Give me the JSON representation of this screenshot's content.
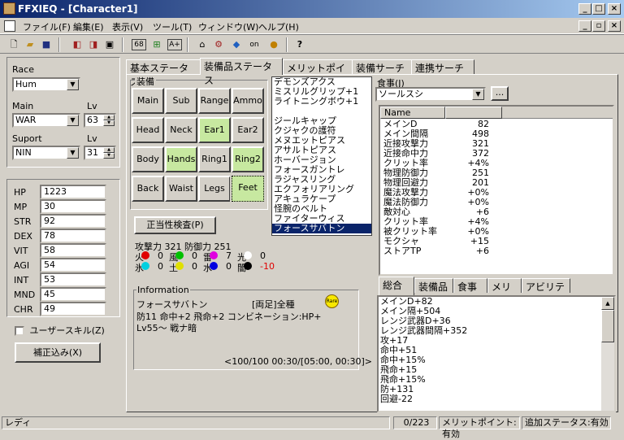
{
  "window": {
    "title": "FFXIEQ - [Character1]"
  },
  "menu": [
    "ファイル(F)",
    "編集(E)",
    "表示(V)",
    "ツール(T)",
    "ウィンドウ(W)",
    "ヘルプ(H)"
  ],
  "character": {
    "race_label": "Race",
    "race_value": "Hum",
    "main_label": "Main",
    "main_value": "WAR",
    "main_lv_label": "Lv",
    "main_lv_value": "63",
    "sub_label": "Suport",
    "sub_value": "NIN",
    "sub_lv_label": "Lv",
    "sub_lv_value": "31"
  },
  "stats": [
    {
      "label": "HP",
      "value": "1223"
    },
    {
      "label": "MP",
      "value": "30"
    },
    {
      "label": "STR",
      "value": "92"
    },
    {
      "label": "DEX",
      "value": "78"
    },
    {
      "label": "VIT",
      "value": "58"
    },
    {
      "label": "AGI",
      "value": "54"
    },
    {
      "label": "INT",
      "value": "53"
    },
    {
      "label": "MND",
      "value": "45"
    },
    {
      "label": "CHR",
      "value": "49"
    }
  ],
  "user_skill_label": "ユーザースキル(Z)",
  "correction_button": "補正込み(X)",
  "tabs": [
    "基本ステータス",
    "装備品ステータス",
    "メリットポイント",
    "装備サーチ",
    "連携サーチ"
  ],
  "equip": {
    "group_label": "装備",
    "slots": [
      {
        "label": "Main",
        "on": false
      },
      {
        "label": "Sub",
        "on": false
      },
      {
        "label": "Range",
        "on": false
      },
      {
        "label": "Ammo",
        "on": false
      },
      {
        "label": "Head",
        "on": false
      },
      {
        "label": "Neck",
        "on": false
      },
      {
        "label": "Ear1",
        "on": true
      },
      {
        "label": "Ear2",
        "on": false
      },
      {
        "label": "Body",
        "on": false
      },
      {
        "label": "Hands",
        "on": true
      },
      {
        "label": "Ring1",
        "on": false
      },
      {
        "label": "Ring2",
        "on": true
      },
      {
        "label": "Back",
        "on": false
      },
      {
        "label": "Waist",
        "on": false
      },
      {
        "label": "Legs",
        "on": false
      },
      {
        "label": "Feet",
        "on": true
      }
    ],
    "validate_button": "正当性検査(P)"
  },
  "equip_list": [
    "デモンズアクス",
    "ミスリルグリップ+1",
    "ライトニングボウ+1",
    "",
    "ジールキャップ",
    "クジャクの護符",
    "メヌエットピアス",
    "アサルトピアス",
    "ホーバージョン",
    "フォースガントレ",
    "ラジャスリング",
    "エクフォリアリング",
    "アキュラケープ",
    "怪腕のベルト",
    "ファイターウィス",
    "フォースサバトン"
  ],
  "equip_list_selected": 15,
  "atk_def": {
    "attack_label": "攻撃力",
    "attack": "321",
    "defense_label": "防御力",
    "defense": "251"
  },
  "elements": [
    {
      "label": "火",
      "color": "#e00000",
      "value": "0"
    },
    {
      "label": "風",
      "color": "#00c000",
      "value": "0"
    },
    {
      "label": "雷",
      "color": "#e000e0",
      "value": "7"
    },
    {
      "label": "光",
      "color": "#ffffff",
      "value": "0"
    },
    {
      "label": "氷",
      "color": "#00d0e0",
      "value": "0"
    },
    {
      "label": "土",
      "color": "#e0e000",
      "value": "0"
    },
    {
      "label": "水",
      "color": "#0000e0",
      "value": "0"
    },
    {
      "label": "闇",
      "color": "#000000",
      "value": "-10"
    }
  ],
  "info": {
    "group_label": "Information",
    "item_name": "フォースサバトン",
    "restriction": "[両足]全種",
    "rare_badge": "Rare",
    "stats_line": "防11 命中+2 飛命+2 コンビネーション:HP+",
    "level_line": "Lv55～ 戦ナ暗",
    "durability": "<100/100 00:30/[05:00, 00:30]>"
  },
  "food": {
    "label": "食事(J)",
    "value": "ソールスシ",
    "button": "..."
  },
  "status_table": {
    "header": "Name",
    "rows": [
      {
        "name": "メインD",
        "value": "82"
      },
      {
        "name": "メイン間隔",
        "value": "498"
      },
      {
        "name": "近接攻撃力",
        "value": "321"
      },
      {
        "name": "近接命中力",
        "value": "372"
      },
      {
        "name": "クリット率",
        "value": "+4%"
      },
      {
        "name": "物理防御力",
        "value": "251"
      },
      {
        "name": "物理回避力",
        "value": "201"
      },
      {
        "name": "魔法攻撃力",
        "value": "+0%"
      },
      {
        "name": "魔法防御力",
        "value": "+0%"
      },
      {
        "name": "敵対心",
        "value": "+6"
      },
      {
        "name": "クリット率",
        "value": "+4%"
      },
      {
        "name": "被クリット率",
        "value": "+0%"
      },
      {
        "name": "モクシャ",
        "value": "+15"
      },
      {
        "name": "ストアTP",
        "value": "+6"
      }
    ]
  },
  "sub_tabs": [
    "総合",
    "装備品",
    "食事",
    "メリポ",
    "アビリティ"
  ],
  "summary_lines": [
    "メインD+82",
    "メイン隔+504",
    "レンジ武器D+36",
    "レンジ武器間隔+352",
    "攻+17",
    "命中+51",
    "命中+15%",
    "飛命+15",
    "飛命+15%",
    "防+131",
    "回避-22"
  ],
  "statusbar": {
    "left": "レディ",
    "count": "0/223",
    "merit": "メリットポイント:有効",
    "extra": "追加ステータス:有効"
  }
}
